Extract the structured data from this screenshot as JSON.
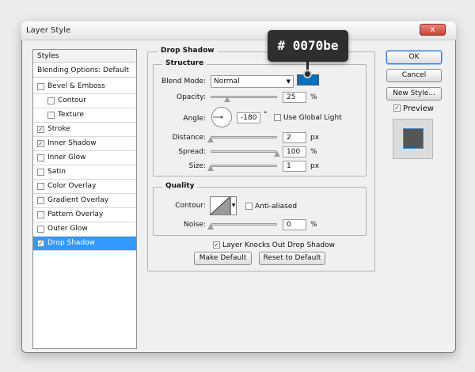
{
  "window": {
    "title": "Layer Style",
    "close_glyph": "x"
  },
  "sidebar": {
    "header": "Styles",
    "blending": "Blending Options: Default",
    "items": [
      {
        "label": "Bevel & Emboss",
        "checked": false,
        "indent": false
      },
      {
        "label": "Contour",
        "checked": false,
        "indent": true
      },
      {
        "label": "Texture",
        "checked": false,
        "indent": true
      },
      {
        "label": "Stroke",
        "checked": true,
        "indent": false
      },
      {
        "label": "Inner Shadow",
        "checked": true,
        "indent": false
      },
      {
        "label": "Inner Glow",
        "checked": false,
        "indent": false
      },
      {
        "label": "Satin",
        "checked": false,
        "indent": false
      },
      {
        "label": "Color Overlay",
        "checked": false,
        "indent": false
      },
      {
        "label": "Gradient Overlay",
        "checked": false,
        "indent": false
      },
      {
        "label": "Pattern Overlay",
        "checked": false,
        "indent": false
      },
      {
        "label": "Outer Glow",
        "checked": false,
        "indent": false
      },
      {
        "label": "Drop Shadow",
        "checked": true,
        "indent": false,
        "selected": true
      }
    ]
  },
  "drop_shadow": {
    "section_title": "Drop Shadow",
    "structure": {
      "title": "Structure",
      "blend_mode_label": "Blend Mode:",
      "blend_mode_value": "Normal",
      "color": "#0070be",
      "opacity_label": "Opacity:",
      "opacity_value": "25",
      "angle_label": "Angle:",
      "angle_value": "-180",
      "degree_symbol": "°",
      "use_global_light_label": "Use Global Light",
      "use_global_light_checked": false,
      "distance_label": "Distance:",
      "distance_value": "2",
      "spread_label": "Spread:",
      "spread_value": "100",
      "size_label": "Size:",
      "size_value": "1",
      "unit_px": "px",
      "unit_pct": "%"
    },
    "quality": {
      "title": "Quality",
      "contour_label": "Contour:",
      "anti_aliased_label": "Anti-aliased",
      "anti_aliased_checked": false,
      "noise_label": "Noise:",
      "noise_value": "0"
    },
    "knockout_label": "Layer Knocks Out Drop Shadow",
    "knockout_checked": true,
    "make_default": "Make Default",
    "reset_default": "Reset to Default"
  },
  "buttons": {
    "ok": "OK",
    "cancel": "Cancel",
    "new_style": "New Style...",
    "preview_label": "Preview",
    "preview_checked": true
  },
  "tooltip": {
    "text": "# 0070be"
  },
  "checkmark_glyph": "✓",
  "icons": {
    "close": "close-icon",
    "dropdown": "chevron-down-icon",
    "angle_dial": "angle-dial-icon",
    "contour_curve": "contour-curve-icon"
  }
}
